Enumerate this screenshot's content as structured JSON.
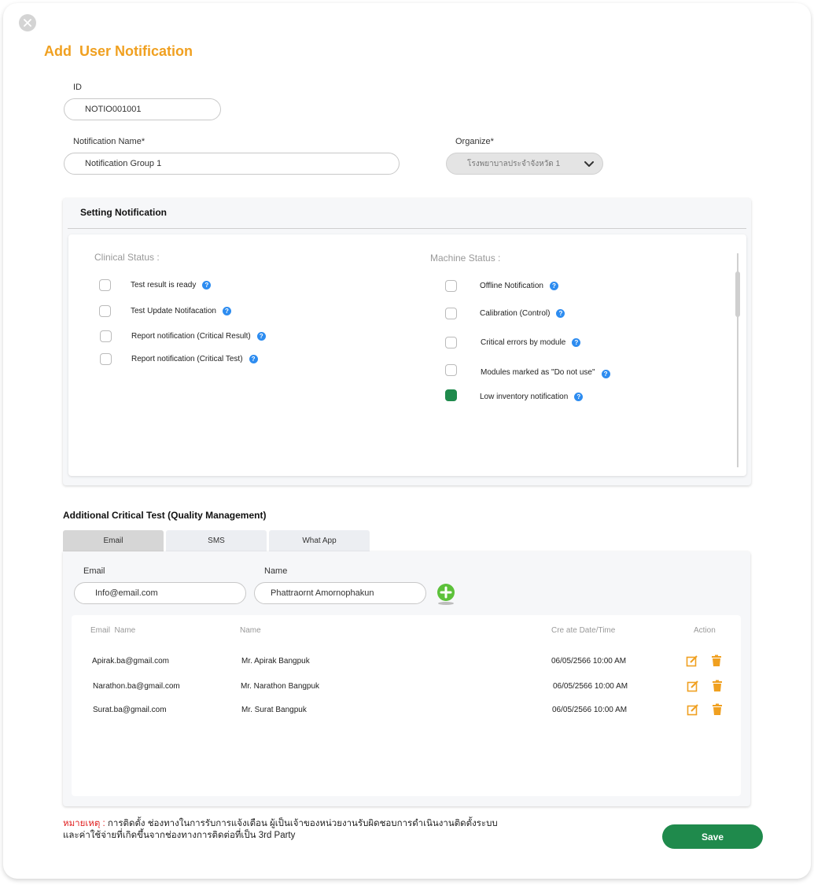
{
  "header": {
    "title": "Add  User Notification"
  },
  "form": {
    "id_label": "ID",
    "id_value": "NOTIO001001",
    "name_label": "Notification Name*",
    "name_value": "Notification Group 1",
    "organize_label": "Organize*",
    "organize_value": "โรงพยาบาลประจำจังหวัด  1"
  },
  "setting": {
    "title": "Setting Notification",
    "clinical_title": "Clinical Status :",
    "machine_title": "Machine Status  :",
    "clinical_items": [
      {
        "label": "Test result is ready",
        "checked": false
      },
      {
        "label": "Test Update Notifacation",
        "checked": false
      },
      {
        "label": "Report notification (Critical Result)",
        "checked": false
      },
      {
        "label": "Report notification (Critical Test)",
        "checked": false
      }
    ],
    "machine_items": [
      {
        "label": "Offline Notification",
        "checked": false
      },
      {
        "label": "Calibration (Control)",
        "checked": false
      },
      {
        "label": "Critical errors by module",
        "checked": false
      },
      {
        "label": "Modules marked as \"Do not use\"",
        "checked": false
      },
      {
        "label": "Low inventory notification",
        "checked": true
      }
    ],
    "help_glyph": "?"
  },
  "critical": {
    "title": "Additional Critical Test (Quality Management)",
    "tabs": [
      "Email",
      "SMS",
      "What App"
    ],
    "email_label": "Email",
    "email_value": "Info@email.com",
    "name_label": "Name",
    "name_value": "Phattraornt  Amornophakun",
    "table": {
      "headers": [
        "Email  Name",
        "Name",
        "Cre ate Date/Time",
        "Action"
      ],
      "rows": [
        [
          "Apirak.ba@gmail.com",
          "Mr. Apirak Bangpuk",
          "06/05/2566 10:00 AM"
        ],
        [
          "Narathon.ba@gmail.com",
          "Mr. Narathon Bangpuk",
          "06/05/2566 10:00 AM"
        ],
        [
          "Surat.ba@gmail.com",
          "Mr. Surat Bangpuk",
          "06/05/2566 10:00 AM"
        ]
      ]
    }
  },
  "footer": {
    "note_highlight": "หมายเหตุ :",
    "note_line1": " การติดตั้ง ช่องทางในการรับการแจ้งเตือน ผู้เป็นเจ้าของหน่วยงานรับผิดชอบการดำเนินงานติดตั้งระบบ",
    "note_line2": "และค่าใช้จ่ายที่เกิดขึ้นจากช่องทางการติดต่อที่เป็น 3rd Party",
    "save_label": "Save"
  },
  "colors": {
    "accent": "#f0a020",
    "primary": "#1f8a4c",
    "help": "#2d8cf0",
    "danger": "#e02020"
  }
}
